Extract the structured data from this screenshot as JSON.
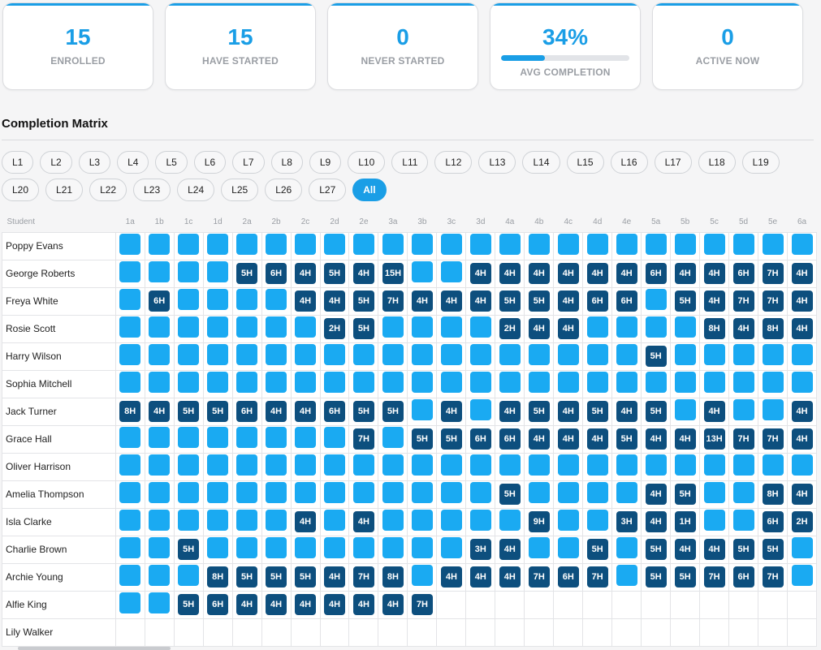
{
  "stats": [
    {
      "value": "15",
      "label": "ENROLLED"
    },
    {
      "value": "15",
      "label": "HAVE STARTED"
    },
    {
      "value": "0",
      "label": "NEVER STARTED"
    },
    {
      "value": "34%",
      "label": "AVG COMPLETION",
      "progress": 0.34
    },
    {
      "value": "0",
      "label": "ACTIVE NOW"
    }
  ],
  "section_title": "Completion Matrix",
  "filters": [
    "L1",
    "L2",
    "L3",
    "L4",
    "L5",
    "L6",
    "L7",
    "L8",
    "L9",
    "L10",
    "L11",
    "L12",
    "L13",
    "L14",
    "L15",
    "L16",
    "L17",
    "L18",
    "L19",
    "L20",
    "L21",
    "L22",
    "L23",
    "L24",
    "L25",
    "L26",
    "L27",
    "All"
  ],
  "active_filter": "All",
  "matrix": {
    "student_header": "Student",
    "columns": [
      "1a",
      "1b",
      "1c",
      "1d",
      "2a",
      "2b",
      "2c",
      "2d",
      "2e",
      "3a",
      "3b",
      "3c",
      "3d",
      "4a",
      "4b",
      "4c",
      "4d",
      "4e",
      "5a",
      "5b",
      "5c",
      "5d",
      "5e",
      "6a"
    ],
    "rows": [
      {
        "name": "Poppy Evans",
        "cells": [
          "p",
          "p",
          "p",
          "p",
          "p",
          "p",
          "p",
          "p",
          "p",
          "p",
          "p",
          "p",
          "p",
          "p",
          "p",
          "p",
          "p",
          "p",
          "p",
          "p",
          "p",
          "p",
          "p",
          "p"
        ]
      },
      {
        "name": "George Roberts",
        "cells": [
          "p",
          "p",
          "p",
          "p",
          "5H",
          "6H",
          "4H",
          "5H",
          "4H",
          "15H",
          "p",
          "p",
          "4H",
          "4H",
          "4H",
          "4H",
          "4H",
          "4H",
          "6H",
          "4H",
          "4H",
          "6H",
          "7H",
          "4H"
        ]
      },
      {
        "name": "Freya White",
        "cells": [
          "p",
          "6H",
          "p",
          "p",
          "p",
          "p",
          "4H",
          "4H",
          "5H",
          "7H",
          "4H",
          "4H",
          "4H",
          "5H",
          "5H",
          "4H",
          "6H",
          "6H",
          "p",
          "5H",
          "4H",
          "7H",
          "7H",
          "4H"
        ]
      },
      {
        "name": "Rosie Scott",
        "cells": [
          "p",
          "p",
          "p",
          "p",
          "p",
          "p",
          "p",
          "2H",
          "5H",
          "p",
          "p",
          "p",
          "p",
          "2H",
          "4H",
          "4H",
          "p",
          "p",
          "p",
          "p",
          "8H",
          "4H",
          "8H",
          "4H"
        ]
      },
      {
        "name": "Harry Wilson",
        "cells": [
          "p",
          "p",
          "p",
          "p",
          "p",
          "p",
          "p",
          "p",
          "p",
          "p",
          "p",
          "p",
          "p",
          "p",
          "p",
          "p",
          "p",
          "p",
          "5H",
          "p",
          "p",
          "p",
          "p",
          "p"
        ]
      },
      {
        "name": "Sophia Mitchell",
        "cells": [
          "p",
          "p",
          "p",
          "p",
          "p",
          "p",
          "p",
          "p",
          "p",
          "p",
          "p",
          "p",
          "p",
          "p",
          "p",
          "p",
          "p",
          "p",
          "p",
          "p",
          "p",
          "p",
          "p",
          "p"
        ]
      },
      {
        "name": "Jack Turner",
        "cells": [
          "8H",
          "4H",
          "5H",
          "5H",
          "6H",
          "4H",
          "4H",
          "6H",
          "5H",
          "5H",
          "p",
          "4H",
          "p",
          "4H",
          "5H",
          "4H",
          "5H",
          "4H",
          "5H",
          "p",
          "4H",
          "p",
          "p",
          "4H"
        ]
      },
      {
        "name": "Grace Hall",
        "cells": [
          "p",
          "p",
          "p",
          "p",
          "p",
          "p",
          "p",
          "p",
          "7H",
          "p",
          "5H",
          "5H",
          "6H",
          "6H",
          "4H",
          "4H",
          "4H",
          "5H",
          "4H",
          "4H",
          "13H",
          "7H",
          "7H",
          "4H"
        ]
      },
      {
        "name": "Oliver Harrison",
        "cells": [
          "p",
          "p",
          "p",
          "p",
          "p",
          "p",
          "p",
          "p",
          "p",
          "p",
          "p",
          "p",
          "p",
          "p",
          "p",
          "p",
          "p",
          "p",
          "p",
          "p",
          "p",
          "p",
          "p",
          "p"
        ]
      },
      {
        "name": "Amelia Thompson",
        "cells": [
          "p",
          "p",
          "p",
          "p",
          "p",
          "p",
          "p",
          "p",
          "p",
          "p",
          "p",
          "p",
          "p",
          "5H",
          "p",
          "p",
          "p",
          "p",
          "4H",
          "5H",
          "p",
          "p",
          "8H",
          "4H"
        ]
      },
      {
        "name": "Isla Clarke",
        "cells": [
          "p",
          "p",
          "p",
          "p",
          "p",
          "p",
          "4H",
          "p",
          "4H",
          "p",
          "p",
          "p",
          "p",
          "p",
          "9H",
          "p",
          "p",
          "3H",
          "4H",
          "1H",
          "p",
          "p",
          "6H",
          "2H"
        ]
      },
      {
        "name": "Charlie Brown",
        "cells": [
          "p",
          "p",
          "5H",
          "p",
          "p",
          "p",
          "p",
          "p",
          "p",
          "p",
          "p",
          "p",
          "3H",
          "4H",
          "p",
          "p",
          "5H",
          "p",
          "5H",
          "4H",
          "4H",
          "5H",
          "5H",
          "p"
        ]
      },
      {
        "name": "Archie Young",
        "cells": [
          "p",
          "p",
          "p",
          "8H",
          "5H",
          "5H",
          "5H",
          "4H",
          "7H",
          "8H",
          "p",
          "4H",
          "4H",
          "4H",
          "7H",
          "6H",
          "7H",
          "p",
          "5H",
          "5H",
          "7H",
          "6H",
          "7H",
          "p"
        ]
      },
      {
        "name": "Alfie King",
        "cells": [
          "p",
          "p",
          "5H",
          "6H",
          "4H",
          "4H",
          "4H",
          "4H",
          "4H",
          "4H",
          "7H",
          "",
          "",
          "",
          "",
          "",
          "",
          "",
          "",
          "",
          "",
          "",
          "",
          ""
        ]
      },
      {
        "name": "Lily Walker",
        "cells": [
          "",
          "",
          "",
          "",
          "",
          "",
          "",
          "",
          "",
          "",
          "",
          "",
          "",
          "",
          "",
          "",
          "",
          "",
          "",
          "",
          "",
          "",
          "",
          ""
        ]
      }
    ]
  }
}
